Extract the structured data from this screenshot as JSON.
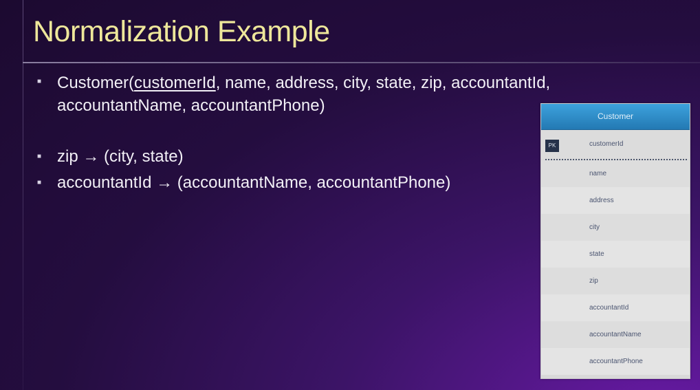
{
  "slide": {
    "title": "Normalization Example",
    "bullets": {
      "relation_name": "Customer(",
      "relation_pk": "customerId",
      "relation_rest_line1": ", name, address, city, state, zip, accountantId,",
      "relation_line2": "accountantName, accountantPhone)",
      "fd1": "zip → (city, state)",
      "fd2": "accountantId → (accountantName, accountantPhone)"
    }
  },
  "table": {
    "name": "Customer",
    "pk_badge": "PK",
    "pk_field": "customerId",
    "fields": [
      "name",
      "address",
      "city",
      "state",
      "zip",
      "accountantId",
      "accountantName",
      "accountantPhone"
    ]
  },
  "colors": {
    "title": "#eee79a",
    "header": "#2a8ac8"
  }
}
